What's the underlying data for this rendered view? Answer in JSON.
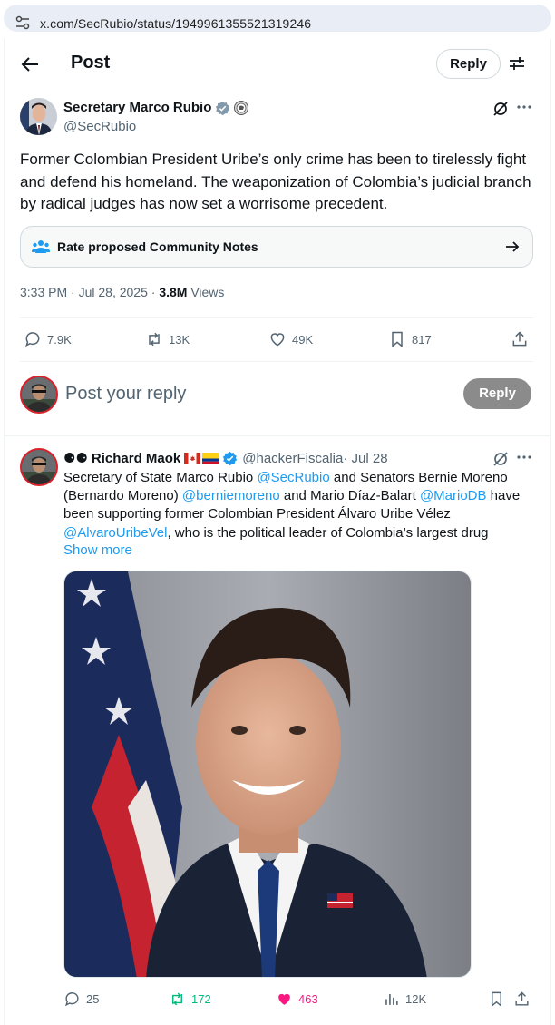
{
  "browser": {
    "url": "x.com/SecRubio/status/1949961355521319246"
  },
  "header": {
    "title": "Post",
    "reply_label": "Reply"
  },
  "tweet": {
    "author_name": "Secretary Marco Rubio",
    "handle": "@SecRubio",
    "text": "Former Colombian President Uribe’s only crime has been to tirelessly fight and defend his homeland. The weaponization of Colombia’s judicial branch by radical judges has now set a worrisome precedent.",
    "community_notes_label": "Rate proposed Community Notes",
    "time": "3:33 PM · Jul 28, 2025 · ",
    "views_count": "3.8M",
    "views_label": " Views",
    "stats": {
      "replies": "7.9K",
      "reposts": "13K",
      "likes": "49K",
      "bookmarks": "817"
    }
  },
  "composer": {
    "placeholder": "Post your reply",
    "button": "Reply"
  },
  "reply_tweet": {
    "name_prefix": "⚈⚈",
    "name": "Richard Maok",
    "handle": "@hackerFiscalia",
    "date": " · Jul 28",
    "text_parts": {
      "p1": "Secretary of State Marco Rubio ",
      "m1": "@SecRubio",
      "p2": " and Senators Bernie Moreno (Bernardo Moreno) ",
      "m2": "@berniemoreno",
      "p3": " and Mario Díaz-Balart ",
      "m3": "@MarioDB",
      "p4": " have been supporting former Colombian President Álvaro Uribe Vélez ",
      "m4": "@AlvaroUribeVel",
      "p5": ", who is the political leader of Colombia’s largest drug"
    },
    "show_more": "Show more",
    "stats": {
      "replies": "25",
      "reposts": "172",
      "likes": "463",
      "views": "12K"
    }
  },
  "colors": {
    "accent": "#1d9bf0",
    "repost_green": "#00ba7c",
    "like_pink": "#f91880",
    "muted": "#536471"
  }
}
